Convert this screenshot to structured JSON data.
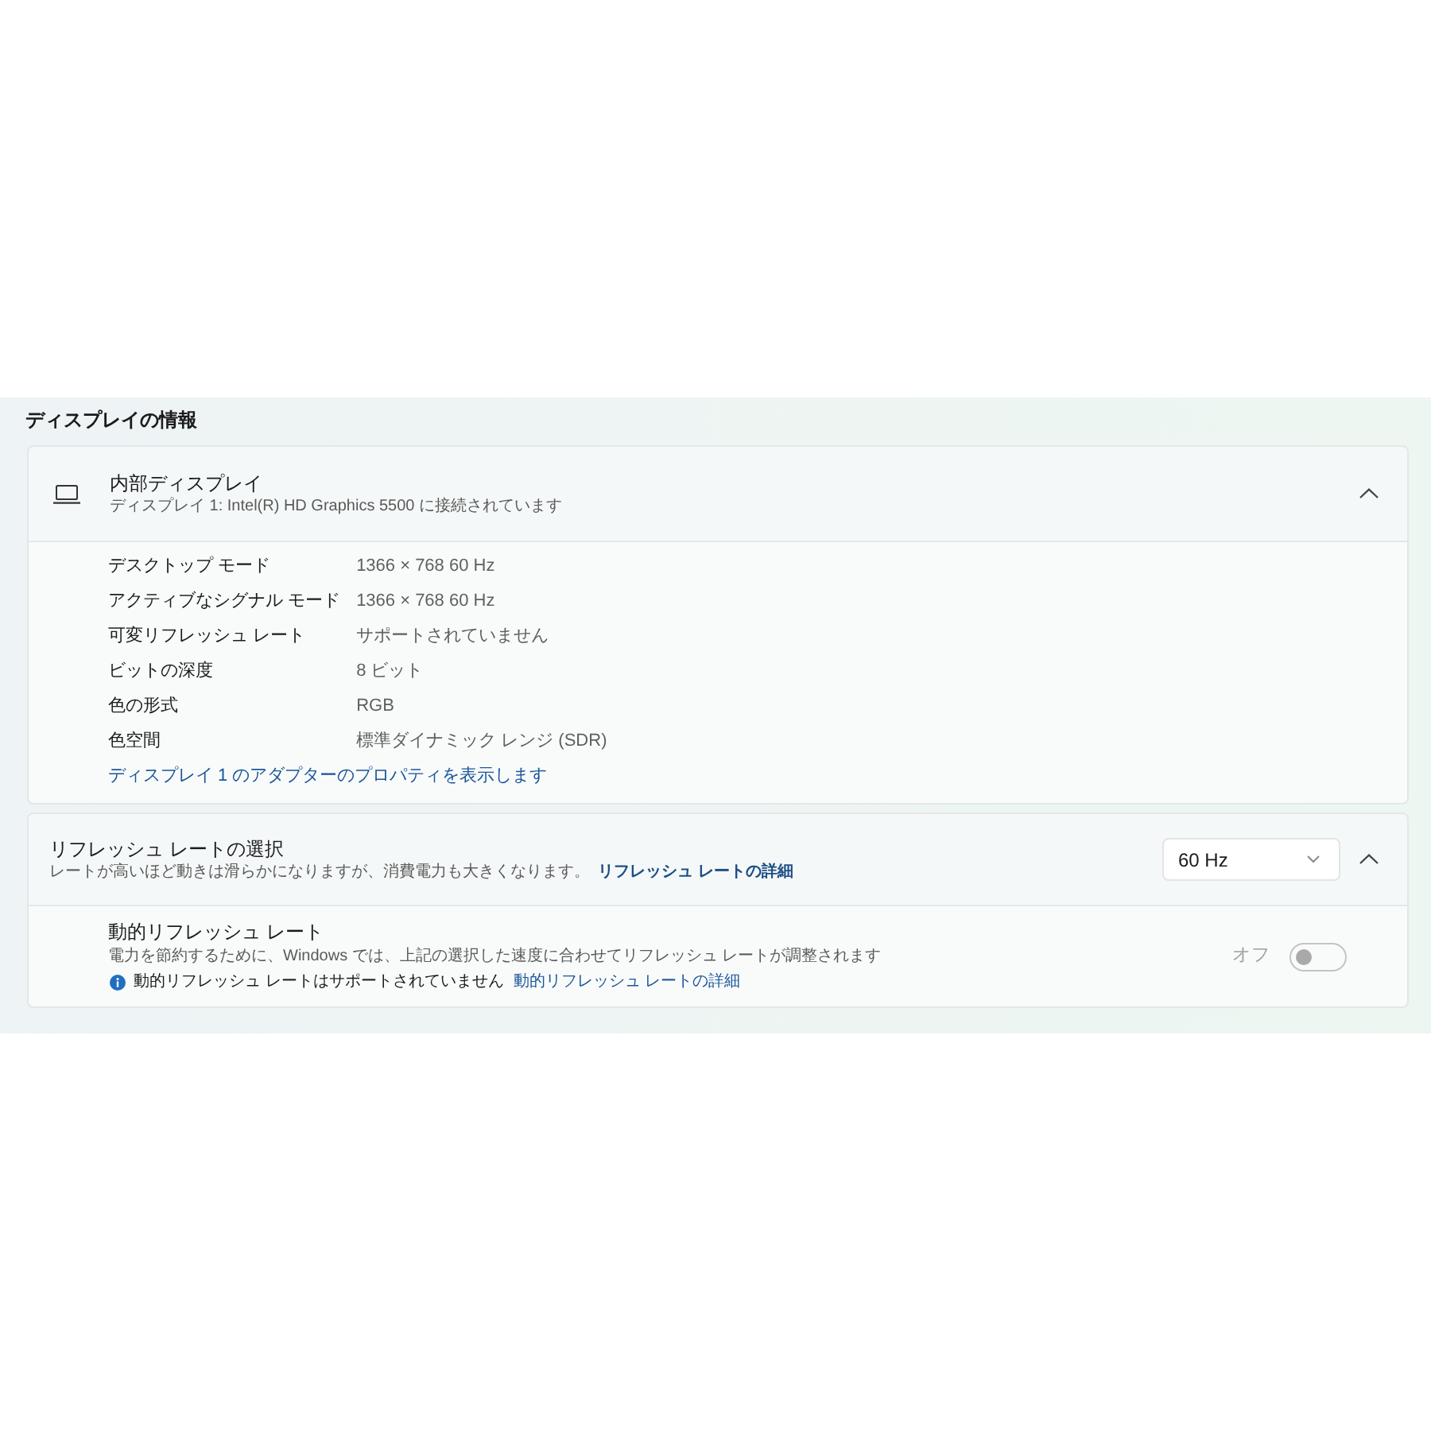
{
  "section_title": "ディスプレイの情報",
  "display_card": {
    "title": "内部ディスプレイ",
    "subtitle": "ディスプレイ 1: Intel(R) HD Graphics 5500 に接続されています",
    "expanded": true,
    "details": [
      {
        "label": "デスクトップ モード",
        "value": "1366 × 768 60 Hz"
      },
      {
        "label": "アクティブなシグナル モード",
        "value": "1366 × 768 60 Hz"
      },
      {
        "label": "可変リフレッシュ レート",
        "value": "サポートされていません"
      },
      {
        "label": "ビットの深度",
        "value": "8 ビット"
      },
      {
        "label": "色の形式",
        "value": "RGB"
      },
      {
        "label": "色空間",
        "value": "標準ダイナミック レンジ (SDR)"
      }
    ],
    "link": "ディスプレイ 1 のアダプターのプロパティを表示します"
  },
  "refresh_card": {
    "title": "リフレッシュ レートの選択",
    "description": "レートが高いほど動きは滑らかになりますが、消費電力も大きくなります。",
    "link": "リフレッシュ レートの詳細",
    "dropdown": {
      "value": "60 Hz"
    },
    "expanded": true,
    "dynamic_refresh": {
      "title": "動的リフレッシュ レート",
      "description": "電力を節約するために、Windows では、上記の選択した速度に合わせてリフレッシュ レートが調整されます",
      "info_text": "動的リフレッシュ レートはサポートされていません",
      "info_link": "動的リフレッシュ レートの詳細",
      "toggle_label": "オフ",
      "on": false,
      "disabled": true
    }
  }
}
